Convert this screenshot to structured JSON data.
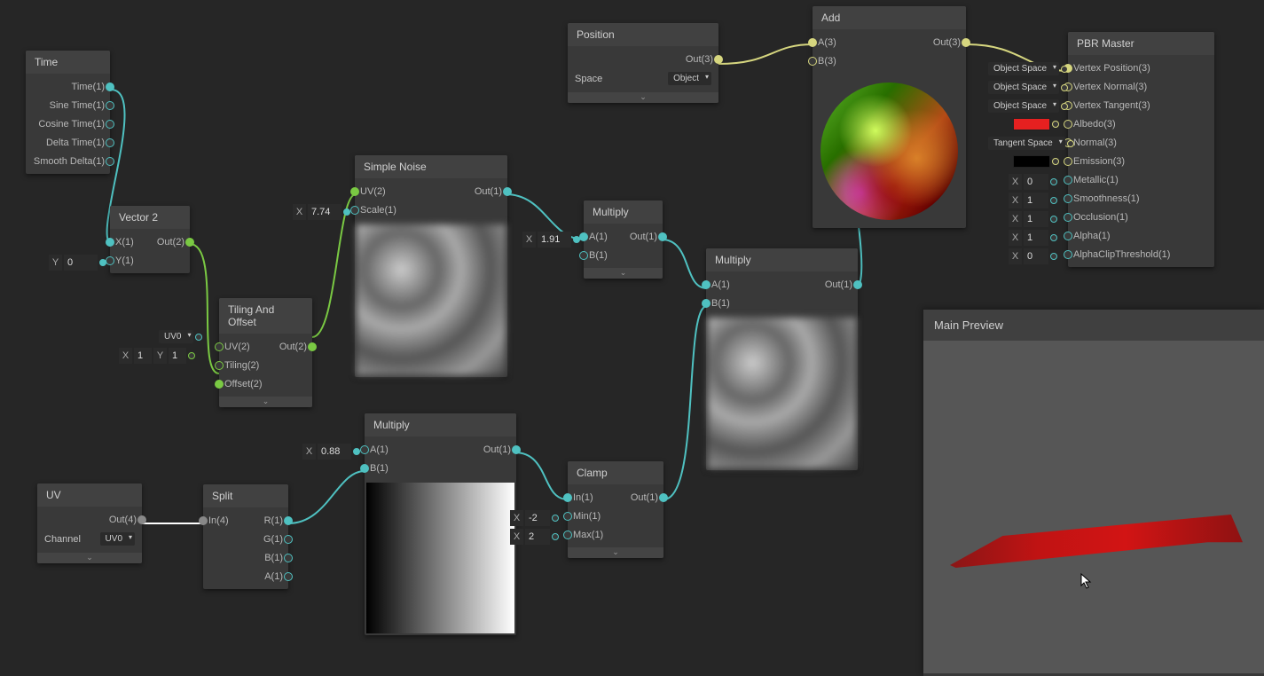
{
  "nodes": {
    "time": {
      "title": "Time",
      "ports": [
        "Time(1)",
        "Sine Time(1)",
        "Cosine Time(1)",
        "Delta Time(1)",
        "Smooth Delta(1)"
      ]
    },
    "vector2": {
      "title": "Vector 2",
      "in": [
        "X(1)",
        "Y(1)"
      ],
      "out": "Out(2)"
    },
    "vector2_y": {
      "label": "Y",
      "value": "0"
    },
    "tiling": {
      "title": "Tiling And Offset",
      "in": [
        "UV(2)",
        "Tiling(2)",
        "Offset(2)"
      ],
      "out": "Out(2)",
      "uvSel": "UV0",
      "txL": "X",
      "txV": "1",
      "tyL": "Y",
      "tyV": "1"
    },
    "simpleNoise": {
      "title": "Simple Noise",
      "in": [
        "UV(2)",
        "Scale(1)"
      ],
      "out": "Out(1)",
      "scaleL": "X",
      "scaleV": "7.74"
    },
    "multiply1": {
      "title": "Multiply",
      "in": [
        "A(1)",
        "B(1)"
      ],
      "out": "Out(1)",
      "xL": "X",
      "xV": "1.91"
    },
    "uv": {
      "title": "UV",
      "out": "Out(4)",
      "channelLabel": "Channel",
      "channelVal": "UV0"
    },
    "split": {
      "title": "Split",
      "in": "In(4)",
      "outs": [
        "R(1)",
        "G(1)",
        "B(1)",
        "A(1)"
      ]
    },
    "multiply2": {
      "title": "Multiply",
      "in": [
        "A(1)",
        "B(1)"
      ],
      "out": "Out(1)",
      "xL": "X",
      "xV": "0.88"
    },
    "clamp": {
      "title": "Clamp",
      "in": [
        "In(1)",
        "Min(1)",
        "Max(1)"
      ],
      "out": "Out(1)",
      "minL": "X",
      "minV": "-2",
      "maxL": "X",
      "maxV": "2"
    },
    "multiply3": {
      "title": "Multiply",
      "in": [
        "A(1)",
        "B(1)"
      ],
      "out": "Out(1)"
    },
    "position": {
      "title": "Position",
      "out": "Out(3)",
      "spaceLabel": "Space",
      "spaceVal": "Object"
    },
    "add": {
      "title": "Add",
      "in": [
        "A(3)",
        "B(3)"
      ],
      "out": "Out(3)"
    },
    "master": {
      "title": "PBR Master",
      "inputs": [
        {
          "label": "Vertex Position(3)",
          "pill": "Object Space"
        },
        {
          "label": "Vertex Normal(3)",
          "pill": "Object Space"
        },
        {
          "label": "Vertex Tangent(3)",
          "pill": "Object Space"
        },
        {
          "label": "Albedo(3)",
          "swatch": "#e62020"
        },
        {
          "label": "Normal(3)",
          "pill": "Tangent Space"
        },
        {
          "label": "Emission(3)",
          "swatch": "#000000"
        },
        {
          "label": "Metallic(1)",
          "numL": "X",
          "numV": "0"
        },
        {
          "label": "Smoothness(1)",
          "numL": "X",
          "numV": "1"
        },
        {
          "label": "Occlusion(1)",
          "numL": "X",
          "numV": "1"
        },
        {
          "label": "Alpha(1)",
          "numL": "X",
          "numV": "1"
        },
        {
          "label": "AlphaClipThreshold(1)",
          "numL": "X",
          "numV": "0"
        }
      ]
    }
  },
  "mainPreview": {
    "title": "Main Preview"
  }
}
